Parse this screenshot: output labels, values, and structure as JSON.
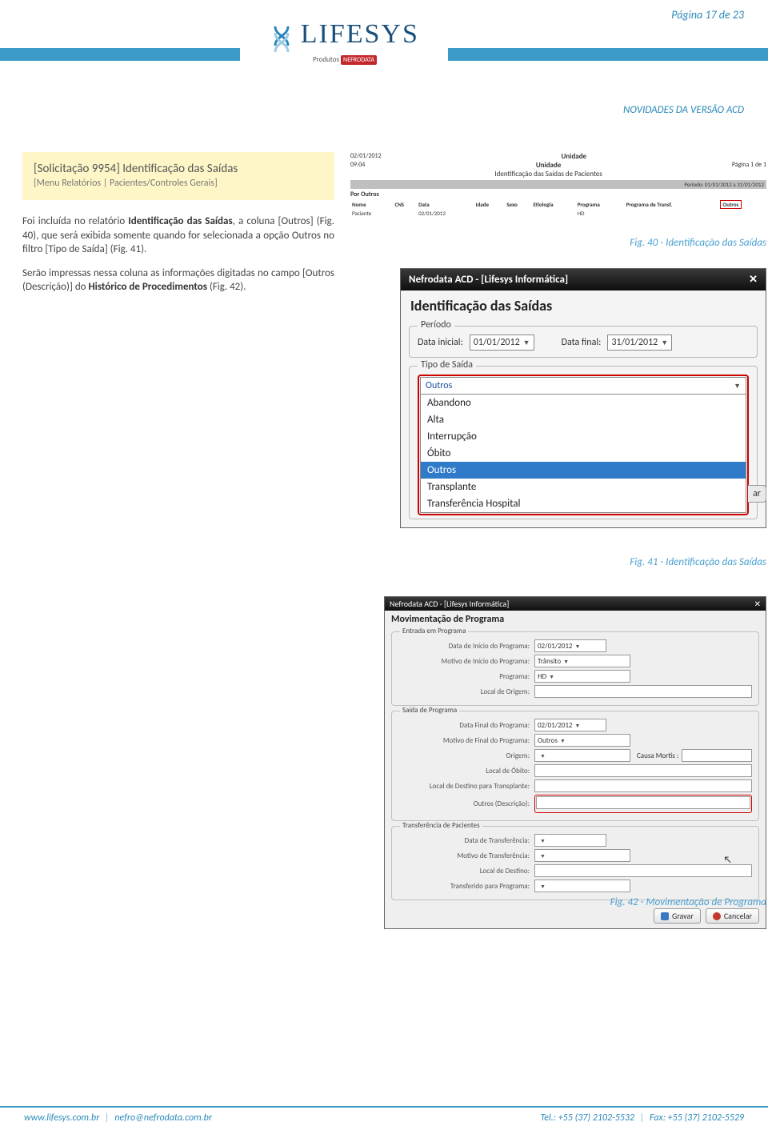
{
  "header": {
    "page_label": "Página 17 de 23",
    "logo_text": "LIFESYS",
    "logo_sub_prefix": "Produtos",
    "logo_sub_brand": "NEFRODATA",
    "subtitle": "NOVIDADES DA VERSÃO ACD"
  },
  "yellow": {
    "title": "[Solicitação 9954] Identificação das Saídas",
    "menu": "[Menu Relatórios | Pacientes/Controles Gerais]"
  },
  "body": {
    "p1_a": "Foi incluída no relatório ",
    "p1_b": "Identificação das Saídas",
    "p1_c": ", a coluna [Outros] (Fig. 40), que será exibida somente quando for selecionada a opção Outros no filtro [Tipo de Saída] (Fig. 41).",
    "p2_a": "Serão impressas nessa coluna as informações digitadas no campo [Outros (Descrição)] do ",
    "p2_b": "Histórico de Procedimentos",
    "p2_c": " (Fig. 42)."
  },
  "fig40": {
    "date_top": "02/01/2012",
    "time": "09:04",
    "center1": "Unidade",
    "center2": "Unidade",
    "center3": "Identificação das Saídas de Pacientes",
    "page": "Página 1 de 1",
    "periodo": "Período: 01/01/2012 a 31/01/2012",
    "por": "Por Outros",
    "cols": [
      "Nome",
      "CNS",
      "Data",
      "Idade",
      "Sexo",
      "Etiologia",
      "Programa",
      "Programa de Transf.",
      "Outros"
    ],
    "row": [
      "Paciente",
      "",
      "02/01/2012",
      "",
      "",
      "",
      "HD",
      "",
      ""
    ],
    "caption": "Fig. 40 - Identificação das Saídas"
  },
  "fig41": {
    "title": "Nefrodata ACD - [Lifesys Informática]",
    "section": "Identificação das Saídas",
    "periodo_legend": "Período",
    "data_inicial_label": "Data inicial:",
    "data_inicial_value": "01/01/2012",
    "data_final_label": "Data final:",
    "data_final_value": "31/01/2012",
    "tipo_legend": "Tipo de Saída",
    "combo_value": "Outros",
    "options": [
      "Abandono",
      "Alta",
      "Interrupção",
      "Óbito",
      "Outros",
      "Transplante",
      "Transferência Hospital"
    ],
    "side_btn": "ar",
    "caption": "Fig. 41 - Identificação das Saídas"
  },
  "fig42": {
    "title": "Nefrodata ACD - [Lifesys Informática]",
    "section": "Movimentação de Programa",
    "entrada_legend": "Entrada em Programa",
    "l_data_inicio": "Data de Início do Programa:",
    "v_data_inicio": "02/01/2012",
    "l_motivo_inicio": "Motivo de Início do Programa:",
    "v_motivo_inicio": "Trânsito",
    "l_programa": "Programa:",
    "v_programa": "HD",
    "l_local_origem": "Local de Origem:",
    "saida_legend": "Saída de Programa",
    "l_data_final": "Data Final do Programa:",
    "v_data_final": "02/01/2012",
    "l_motivo_final": "Motivo de Final do Programa:",
    "v_motivo_final": "Outros",
    "l_origem": "Origem:",
    "l_causa": "Causa Mortis :",
    "l_local_obito": "Local de Óbito:",
    "l_dest_transpl": "Local de Destino para Transplante:",
    "l_outros_desc": "Outros (Descrição):",
    "transf_legend": "Transferência de Pacientes",
    "l_data_transf": "Data de Transferência:",
    "l_motivo_transf": "Motivo de Transferência:",
    "l_local_dest": "Local de Destino:",
    "l_transf_prog": "Transferido para Programa:",
    "btn_gravar": "Gravar",
    "btn_cancelar": "Cancelar",
    "caption": "Fig. 42 - Movimentação de Programa"
  },
  "footer": {
    "left1": "www.lifesys.com.br",
    "left2": "nefro@nefrodata.com.br",
    "right1": "Tel.: +55 (37) 2102-5532",
    "right2": "Fax: +55 (37) 2102-5529"
  }
}
